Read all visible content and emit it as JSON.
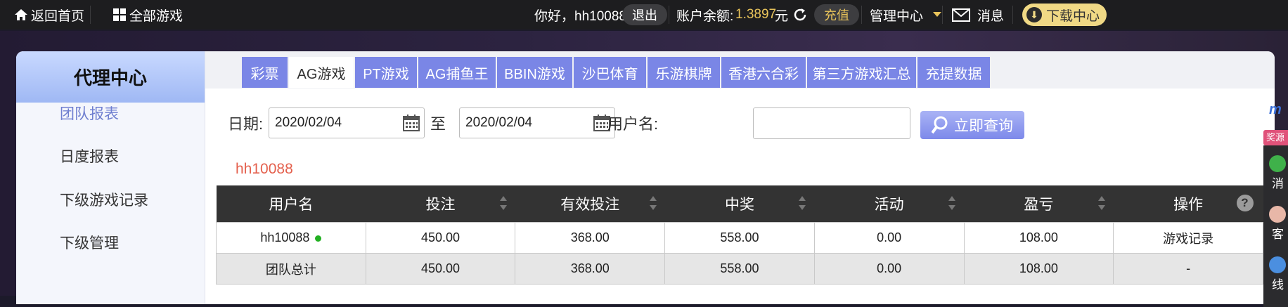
{
  "topbar": {
    "home": "返回首页",
    "all_games": "全部游戏",
    "greeting": "你好，hh10088",
    "logout": "退出",
    "balance_label": "账户余额:",
    "balance_value": "1.3897",
    "balance_unit": "元",
    "recharge": "充值",
    "manage": "管理中心",
    "messages": "消息",
    "download": "下载中心"
  },
  "sidebar": {
    "title": "代理中心",
    "items": [
      {
        "label": "团队报表"
      },
      {
        "label": "日度报表"
      },
      {
        "label": "下级游戏记录"
      },
      {
        "label": "下级管理"
      }
    ]
  },
  "tabs": [
    {
      "label": "彩票"
    },
    {
      "label": "AG游戏"
    },
    {
      "label": "PT游戏"
    },
    {
      "label": "AG捕鱼王"
    },
    {
      "label": "BBIN游戏"
    },
    {
      "label": "沙巴体育"
    },
    {
      "label": "乐游棋牌"
    },
    {
      "label": "香港六合彩"
    },
    {
      "label": "第三方游戏汇总"
    },
    {
      "label": "充提数据"
    }
  ],
  "filter": {
    "date_label": "日期:",
    "date_from": "2020/02/04",
    "to_label": "至",
    "date_to": "2020/02/04",
    "username_label": "用户名:",
    "username_value": "",
    "query": "立即查询"
  },
  "current_user": "hh10088",
  "table": {
    "headers": [
      "用户名",
      "投注",
      "有效投注",
      "中奖",
      "活动",
      "盈亏",
      "操作"
    ],
    "rows": [
      {
        "user": "hh10088",
        "bet": "450.00",
        "valid_bet": "368.00",
        "win": "558.00",
        "activity": "0.00",
        "profit": "108.00",
        "action": "游戏记录"
      },
      {
        "user": "团队总计",
        "bet": "450.00",
        "valid_bet": "368.00",
        "win": "558.00",
        "activity": "0.00",
        "profit": "108.00",
        "action": "-"
      }
    ]
  },
  "float_panel": {
    "badge": "奖源",
    "labels": [
      "消",
      "客",
      "线"
    ]
  },
  "colors": {
    "accent": "#7a86e6",
    "active_side": "#6f7fd0",
    "balance": "#e8c35a",
    "user_tag": "#e4604d",
    "online_dot": "#22b022"
  }
}
